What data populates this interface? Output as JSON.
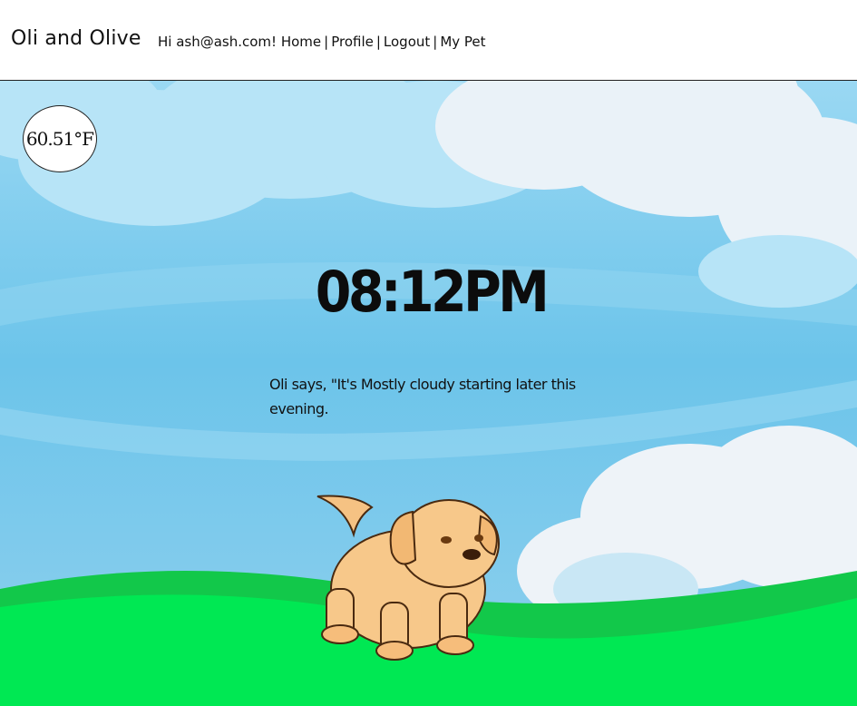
{
  "header": {
    "brand": "Oli and Olive",
    "greeting": "Hi ash@ash.com!",
    "links": [
      "Home",
      "Profile",
      "Logout",
      "My Pet"
    ],
    "separator": "|"
  },
  "weather": {
    "temperature": "60.51°F",
    "time": "08:12PM",
    "message": "Oli says, \"It's Mostly cloudy starting later this evening."
  },
  "colors": {
    "sky": "#68c3ea",
    "sky_light": "#b5e3f6",
    "cloud": "#eef3f8",
    "grass": "#00e853",
    "grass_dark": "#12c84a",
    "dog_fur": "#f7c88a"
  },
  "icons": {
    "pet": "puppy-illustration"
  }
}
